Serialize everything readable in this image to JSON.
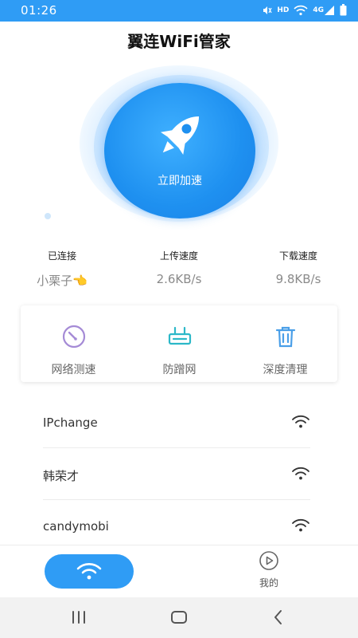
{
  "status_bar": {
    "time": "01:26",
    "icons": [
      "mute-icon",
      "hd-icon",
      "wifi-icon",
      "4g-signal-icon",
      "battery-icon"
    ],
    "hd_label": "HD",
    "network_label": "4G"
  },
  "app": {
    "title": "翼连WiFi管家"
  },
  "boost": {
    "label": "立即加速",
    "icon": "rocket-icon"
  },
  "stats": {
    "connected_label": "已连接",
    "connected_value": "小栗子👈",
    "upload_label": "上传速度",
    "upload_value": "2.6KB/s",
    "download_label": "下载速度",
    "download_value": "9.8KB/s"
  },
  "tools": [
    {
      "label": "网络测速",
      "icon": "speedometer-icon"
    },
    {
      "label": "防蹭网",
      "icon": "router-icon"
    },
    {
      "label": "深度清理",
      "icon": "trash-icon"
    }
  ],
  "wifi_list": [
    {
      "name": "IPchange",
      "icon": "wifi-signal-icon"
    },
    {
      "name": "韩荣才",
      "icon": "wifi-signal-icon"
    },
    {
      "name": "candymobi",
      "icon": "wifi-signal-icon"
    }
  ],
  "bottom_nav": {
    "wifi_icon": "wifi-icon",
    "mine_label": "我的",
    "mine_icon": "play-circle-icon"
  },
  "system_nav": [
    "recent-apps-icon",
    "home-icon",
    "back-icon"
  ],
  "colors": {
    "primary": "#2f9cf5",
    "tool_purple": "#a58bd6",
    "tool_teal": "#2cb8c8",
    "tool_blue": "#4a9fe8"
  }
}
